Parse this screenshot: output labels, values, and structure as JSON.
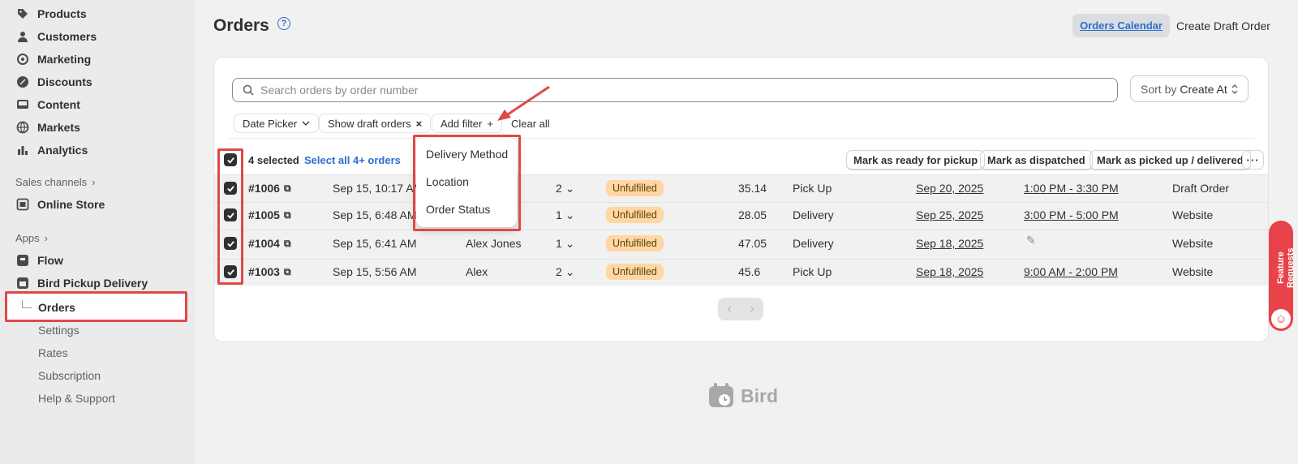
{
  "sidebar": {
    "items": [
      {
        "label": "Products",
        "icon": "tag-icon"
      },
      {
        "label": "Customers",
        "icon": "person-icon"
      },
      {
        "label": "Marketing",
        "icon": "target-icon"
      },
      {
        "label": "Discounts",
        "icon": "discount-icon"
      },
      {
        "label": "Content",
        "icon": "content-icon"
      },
      {
        "label": "Markets",
        "icon": "globe-icon"
      },
      {
        "label": "Analytics",
        "icon": "bar-chart-icon"
      }
    ],
    "sales_channels_label": "Sales channels",
    "online_store_label": "Online Store",
    "apps_label": "Apps",
    "flow_label": "Flow",
    "app_name": "Bird Pickup Delivery",
    "sub_items": [
      "Orders",
      "Settings",
      "Rates",
      "Subscription",
      "Help & Support"
    ]
  },
  "header": {
    "title": "Orders",
    "help_icon_text": "?",
    "calendar_button": "Orders Calendar",
    "draft_button": "Create Draft Order"
  },
  "search": {
    "placeholder": "Search orders by order number"
  },
  "sort": {
    "prefix": "Sort by",
    "value": "Create At"
  },
  "filters": {
    "date_picker": "Date Picker",
    "draft_orders": "Show draft orders",
    "add_filter": "Add filter",
    "clear_all": "Clear all"
  },
  "dropdown": {
    "options": [
      "Delivery Method",
      "Location",
      "Order Status"
    ]
  },
  "bulk": {
    "selected_text": "4 selected",
    "select_all_link": "Select all 4+ orders",
    "actions": [
      "Mark as ready for pickup",
      "Mark as dispatched",
      "Mark as picked up / delivered"
    ],
    "more": "···"
  },
  "orders": [
    {
      "number": "#1006",
      "date": "Sep 15, 10:17 AM",
      "customer": "",
      "items": "2",
      "status": "Unfulfilled",
      "total": "35.14",
      "method": "Pick Up",
      "delivery_date": "Sep 20, 2025",
      "time_slot": "1:00 PM - 3:30 PM",
      "source": "Draft Order"
    },
    {
      "number": "#1005",
      "date": "Sep 15, 6:48 AM",
      "customer": "",
      "items": "1",
      "status": "Unfulfilled",
      "total": "28.05",
      "method": "Delivery",
      "delivery_date": "Sep 25, 2025",
      "time_slot": "3:00 PM - 5:00 PM",
      "source": "Website"
    },
    {
      "number": "#1004",
      "date": "Sep 15, 6:41 AM",
      "customer": "Alex Jones",
      "items": "1",
      "status": "Unfulfilled",
      "total": "47.05",
      "method": "Delivery",
      "delivery_date": "Sep 18, 2025",
      "time_slot": "",
      "source": "Website"
    },
    {
      "number": "#1003",
      "date": "Sep 15, 5:56 AM",
      "customer": "Alex",
      "items": "2",
      "status": "Unfulfilled",
      "total": "45.6",
      "method": "Pick Up",
      "delivery_date": "Sep 18, 2025",
      "time_slot": "9:00 AM - 2:00 PM",
      "source": "Website"
    }
  ],
  "footer": {
    "logo_text": "Bird"
  },
  "feature_tab": {
    "label": "Feature Requests"
  },
  "colors": {
    "accent": "#2c6ecb",
    "highlight": "#e04848",
    "badge": "#ffd6a4",
    "feature_tab": "#e8424a"
  }
}
